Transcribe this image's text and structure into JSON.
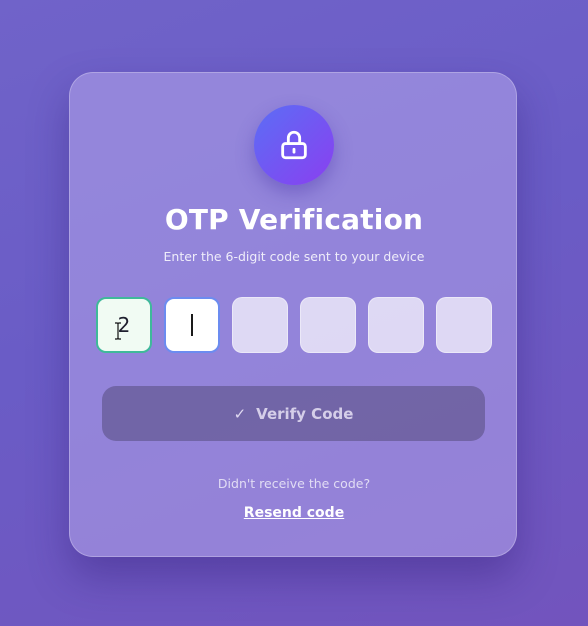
{
  "title": "OTP Verification",
  "subtitle": "Enter the 6-digit code sent to your device",
  "otp": {
    "digits": [
      "2",
      "",
      "",
      "",
      "",
      ""
    ]
  },
  "verify_button": {
    "icon": "check-icon",
    "label": "Verify Code"
  },
  "resend": {
    "question": "Didn't receive the code?",
    "link_label": "Resend code"
  },
  "icons": {
    "header": "lock-icon"
  },
  "colors": {
    "filled_border": "#3fb99a",
    "active_border": "#6c8cf0",
    "lock_gradient_start": "#5b6ef5",
    "lock_gradient_end": "#8a3ff0"
  }
}
